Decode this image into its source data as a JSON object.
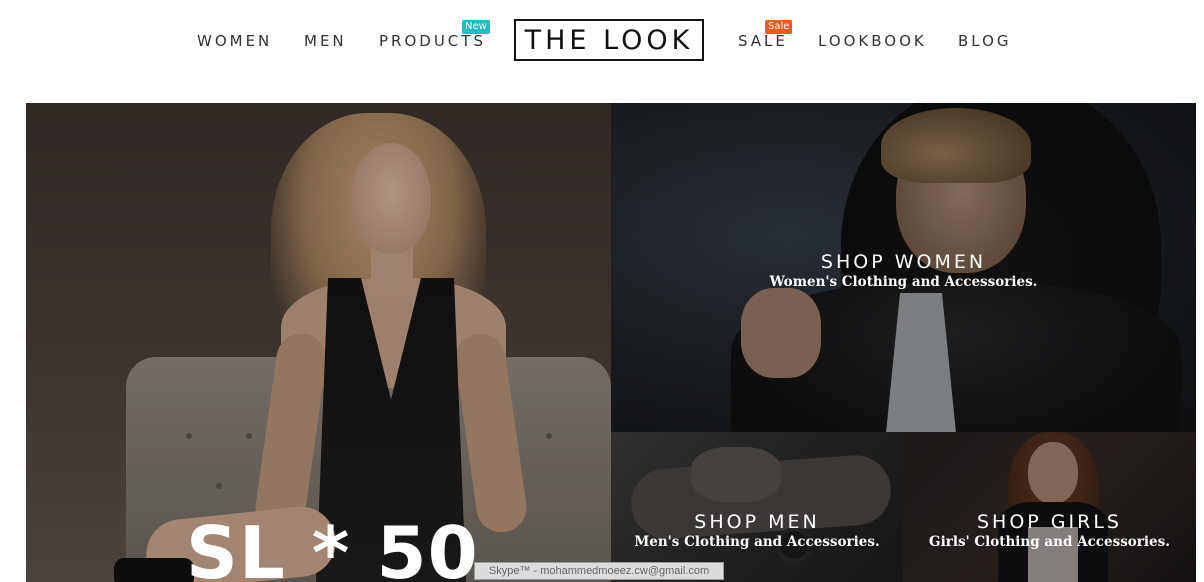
{
  "header": {
    "nav_left": [
      {
        "label": "WOMEN"
      },
      {
        "label": "MEN"
      },
      {
        "label": "PRODUCTS",
        "badge": "New",
        "badge_color": "#1fbfbf"
      }
    ],
    "logo": "THE LOOK",
    "nav_right": [
      {
        "label": "SALE",
        "badge": "Sale",
        "badge_color": "#f25a1f"
      },
      {
        "label": "LOOKBOOK"
      },
      {
        "label": "BLOG"
      }
    ]
  },
  "hero": {
    "caption": "SL * 50"
  },
  "categories": {
    "women": {
      "title": "SHOP WOMEN",
      "subtitle": "Women's Clothing and Accessories."
    },
    "men": {
      "title": "SHOP MEN",
      "subtitle": "Men's Clothing and Accessories."
    },
    "girls": {
      "title": "SHOP GIRLS",
      "subtitle": "Girls' Clothing and Accessories."
    }
  },
  "tooltip": {
    "text": "Skype™ - mohammedmoeez.cw@gmail.com"
  }
}
